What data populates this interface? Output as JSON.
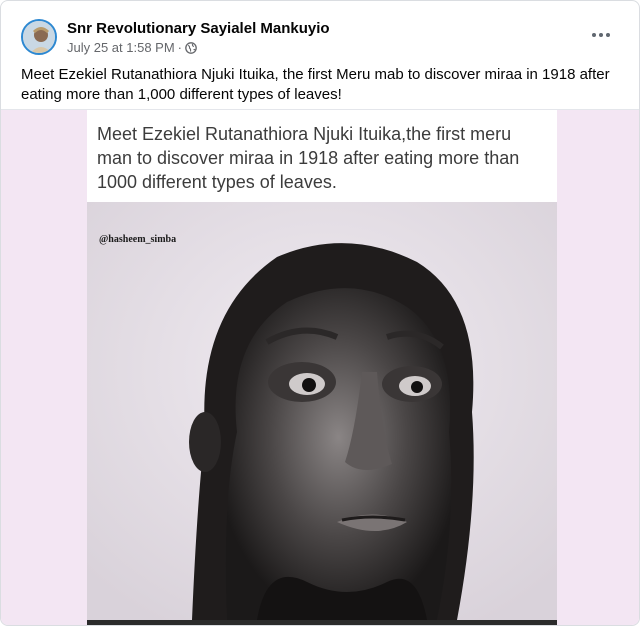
{
  "post": {
    "author": "Snr Revolutionary Sayialel Mankuyio",
    "date": "July 25 at 1:58 PM",
    "separator": "·",
    "privacy_icon": "globe-icon",
    "more_icon": "more-options-icon",
    "text": "Meet Ezekiel Rutanathiora Njuki Ituika, the first Meru mab to discover miraa in 1918 after eating more than 1,000 different types of leaves!"
  },
  "image": {
    "caption": "Meet Ezekiel Rutanathiora Njuki Ituika,the first meru man to discover miraa in 1918 after eating more than 1000 different types of leaves.",
    "handle": "@hasheem_simba",
    "background_color": "#f3e6f3"
  }
}
